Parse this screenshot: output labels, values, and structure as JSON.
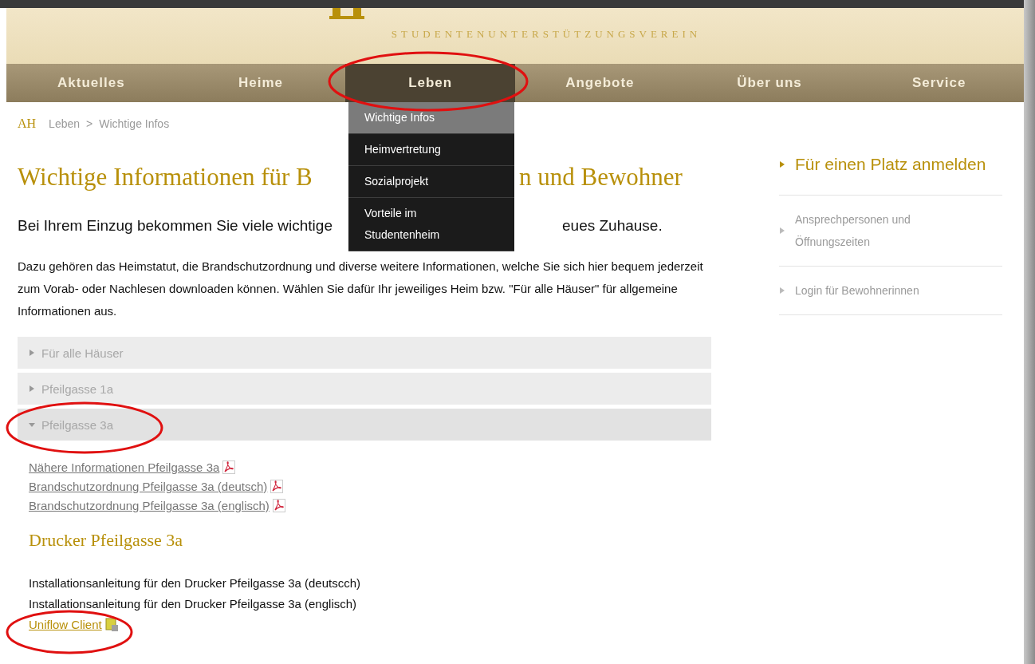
{
  "header": {
    "subtitle": "STUDENTENUNTERSTÜTZUNGSVEREIN"
  },
  "nav": [
    {
      "label": "Aktuelles",
      "selected": false
    },
    {
      "label": "Heime",
      "selected": false
    },
    {
      "label": "Leben",
      "selected": true
    },
    {
      "label": "Angebote",
      "selected": false
    },
    {
      "label": "Über uns",
      "selected": false
    },
    {
      "label": "Service",
      "selected": false
    }
  ],
  "dropdown": [
    {
      "label": "Wichtige Infos",
      "selected": true
    },
    {
      "label": "Heimvertretung",
      "selected": false
    },
    {
      "label": "Sozialprojekt",
      "selected": false
    },
    {
      "label": "Vorteile im Studentenheim",
      "selected": false
    }
  ],
  "breadcrumb": {
    "logo": "AH",
    "items": [
      "Leben",
      "Wichtige Infos"
    ],
    "separator": ">"
  },
  "heading_parts": [
    "Wichtige Informationen für B",
    "n und Bewohner"
  ],
  "intro_parts": [
    "Bei Ihrem Einzug bekommen Sie viele wichtige",
    "eues Zuhause."
  ],
  "paragraph": "Dazu gehören das Heimstatut, die Brandschutzordnung und diverse weitere Informationen, welche Sie sich hier bequem jederzeit zum Vorab- oder Nachlesen downloaden können. Wählen Sie dafür Ihr jeweiliges Heim bzw. \"Für alle Häuser\" für allgemeine Informationen aus.",
  "accordion": [
    {
      "label": "Für alle Häuser",
      "expanded": false
    },
    {
      "label": "Pfeilgasse 1a",
      "expanded": false
    },
    {
      "label": "Pfeilgasse 3a",
      "expanded": true
    }
  ],
  "pdf_links": [
    "Nähere Informationen Pfeilgasse 3a",
    "Brandschutzordnung Pfeilgasse 3a (deutsch)",
    "Brandschutzordnung Pfeilgasse 3a (englisch)"
  ],
  "printer_heading": "Drucker Pfeilgasse 3a",
  "printer_lines": [
    "Installationsanleitung für den Drucker Pfeilgasse 3a (deutscch)",
    "Installationsanleitung für den Drucker Pfeilgasse 3a (englisch)"
  ],
  "printer_link": "Uniflow Client",
  "sidebar": [
    {
      "label": "Für einen Platz anmelden",
      "kind": "primary"
    },
    {
      "label": "Ansprechpersonen und Öffnungszeiten",
      "kind": "secondary"
    },
    {
      "label": "Login für Bewohnerinnen",
      "kind": "secondary"
    }
  ]
}
